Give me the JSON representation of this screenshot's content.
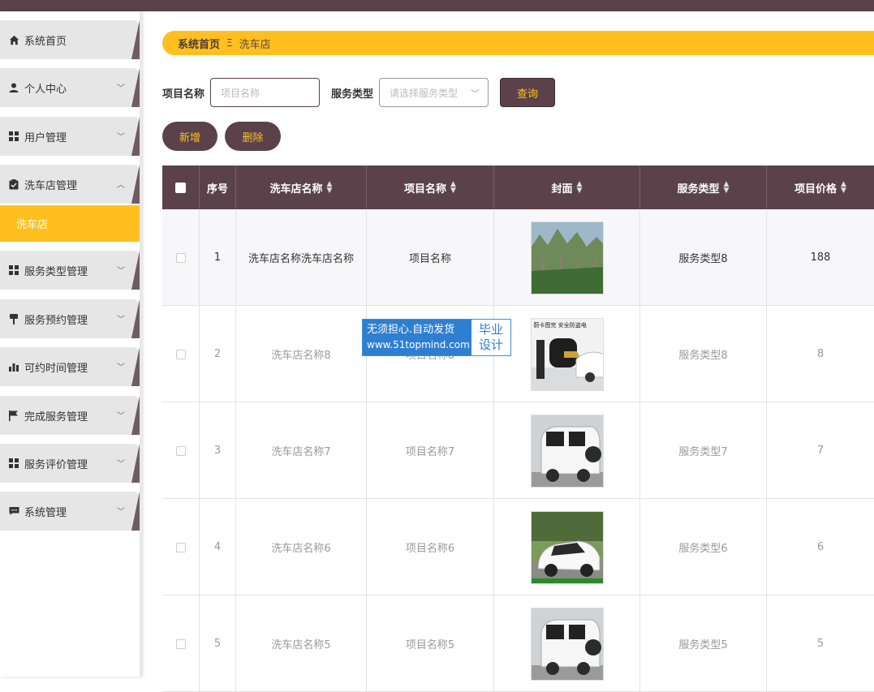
{
  "colors": {
    "primary": "#5b424a",
    "accent": "#ffc01f"
  },
  "sidebar": {
    "items": [
      {
        "label": "系统首页",
        "icon": "home-icon",
        "expandable": false
      },
      {
        "label": "个人中心",
        "icon": "user-icon",
        "expandable": true
      },
      {
        "label": "用户管理",
        "icon": "grid-icon",
        "expandable": true
      },
      {
        "label": "洗车店管理",
        "icon": "clipboard-icon",
        "expandable": true,
        "expanded": true
      },
      {
        "label": "服务类型管理",
        "icon": "grid-icon",
        "expandable": true
      },
      {
        "label": "服务预约管理",
        "icon": "pin-icon",
        "expandable": true
      },
      {
        "label": "可约时间管理",
        "icon": "bar-chart-icon",
        "expandable": true
      },
      {
        "label": "完成服务管理",
        "icon": "flag-icon",
        "expandable": true
      },
      {
        "label": "服务评价管理",
        "icon": "grid-icon",
        "expandable": true
      },
      {
        "label": "系统管理",
        "icon": "chat-icon",
        "expandable": true
      }
    ],
    "submenu": {
      "label": "洗车店"
    }
  },
  "breadcrumb": {
    "home": "系统首页",
    "separator": "Ξ",
    "current": "洗车店"
  },
  "search": {
    "project_label": "项目名称",
    "project_placeholder": "项目名称",
    "service_label": "服务类型",
    "service_placeholder": "请选择服务类型",
    "query_button": "查询"
  },
  "actions": {
    "add": "新增",
    "delete": "删除"
  },
  "table": {
    "headers": [
      "序号",
      "洗车店名称",
      "项目名称",
      "封面",
      "服务类型",
      "项目价格"
    ],
    "rows": [
      {
        "index": "1",
        "shop": "洗车店名称洗车店名称",
        "project": "项目名称",
        "cover": "mountain-photo",
        "service": "服务类型8",
        "price": "188"
      },
      {
        "index": "2",
        "shop": "洗车店名称8",
        "project": "项目名称8",
        "cover": "charger-ad",
        "service": "服务类型8",
        "price": "8"
      },
      {
        "index": "3",
        "shop": "洗车店名称7",
        "project": "项目名称7",
        "cover": "white-car-photo",
        "service": "服务类型7",
        "price": "7"
      },
      {
        "index": "4",
        "shop": "洗车店名称6",
        "project": "项目名称6",
        "cover": "small-white-car-photo",
        "service": "服务类型6",
        "price": "6"
      },
      {
        "index": "5",
        "shop": "洗车店名称5",
        "project": "项目名称5",
        "cover": "white-car-photo",
        "service": "服务类型5",
        "price": "5"
      }
    ]
  },
  "watermark": {
    "line1": "无须担心.自动发货",
    "line2": "www.51topmind.com",
    "right1": "毕业",
    "right2": "设计"
  },
  "cover_texts": {
    "charger_title": "蔚卡图完 安全防盗电"
  }
}
